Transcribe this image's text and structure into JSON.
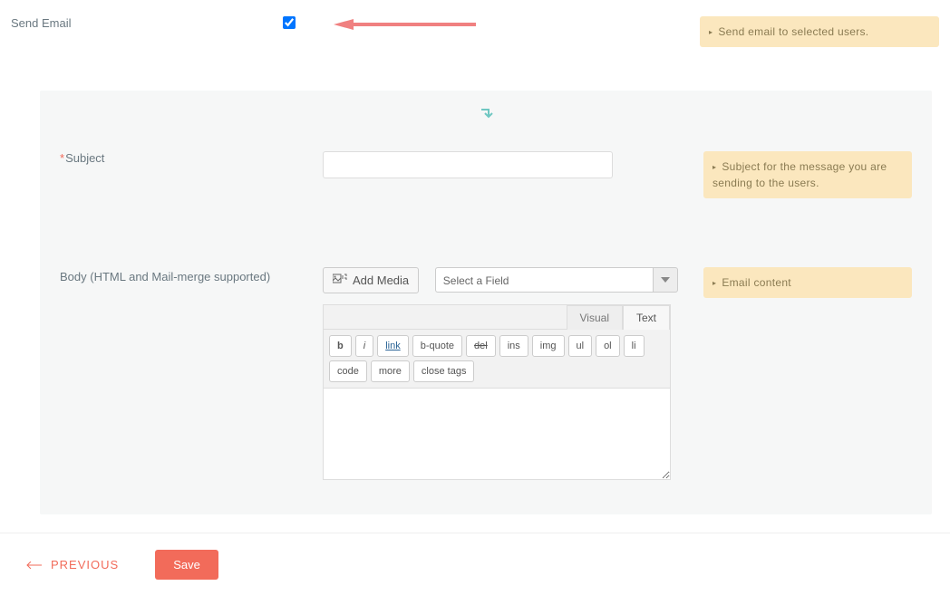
{
  "send_email": {
    "label": "Send Email",
    "checked": true,
    "help": "Send email to selected users."
  },
  "subject": {
    "label": "Subject",
    "required": true,
    "value": "",
    "help": "Subject for the message you are sending to the users."
  },
  "body": {
    "label": "Body (HTML and Mail-merge supported)",
    "add_media_label": "Add Media",
    "select_placeholder": "Select a Field",
    "help": "Email content",
    "tabs": {
      "visual": "Visual",
      "text": "Text",
      "active": "text"
    },
    "quicktags": {
      "b": "b",
      "i": "i",
      "link": "link",
      "bquote": "b-quote",
      "del": "del",
      "ins": "ins",
      "img": "img",
      "ul": "ul",
      "ol": "ol",
      "li": "li",
      "code": "code",
      "more": "more",
      "close": "close tags"
    },
    "content": ""
  },
  "footer": {
    "previous": "PREVIOUS",
    "save": "Save"
  }
}
